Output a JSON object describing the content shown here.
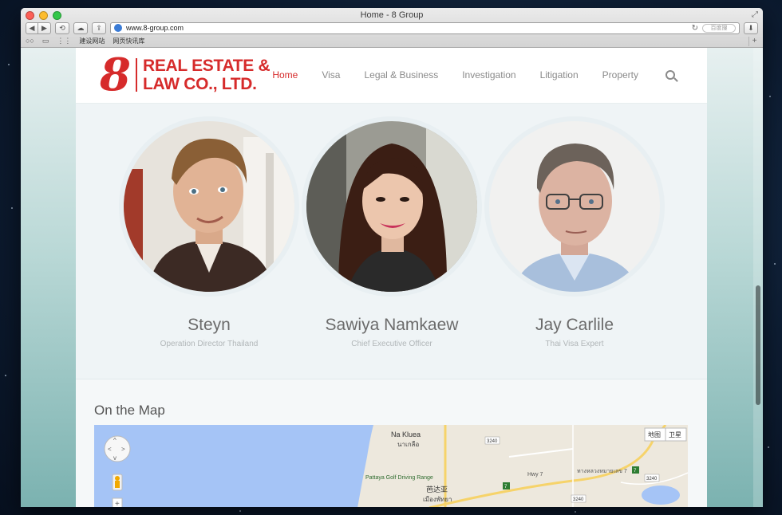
{
  "browser": {
    "window_title": "Home - 8 Group",
    "url": "www.8-group.com",
    "search_placeholder": "百度搜",
    "bookmarks": [
      "建设网站",
      "网页快讯库"
    ]
  },
  "site": {
    "logo": {
      "mark": "8",
      "line1": "REAL ESTATE &",
      "line2": "LAW CO., LTD."
    },
    "nav": [
      "Home",
      "Visa",
      "Legal & Business",
      "Investigation",
      "Litigation",
      "Property"
    ],
    "active_nav": "Home",
    "accent_color": "#d62b2b"
  },
  "team": [
    {
      "name": "Steyn",
      "role": "Operation Director Thailand"
    },
    {
      "name": "Sawiya Namkaew",
      "role": "Chief Executive Officer"
    },
    {
      "name": "Jay Carlile",
      "role": "Thai Visa Expert"
    }
  ],
  "map": {
    "title": "On the Map",
    "buttons": [
      "地图",
      "卫星"
    ],
    "labels": {
      "place1": "Na Kluea",
      "place1_thai": "นาเกลือ",
      "place2": "Pattaya Golf Driving Range",
      "place3": "芭达亚",
      "place3_thai": "เมืองพัทยา",
      "road": "ทางหลวงหมายเลข 7",
      "road_en": "Hwy 7",
      "r1": "3240",
      "r2": "3240",
      "r3": "3240",
      "r4": "7",
      "r5": "7"
    }
  }
}
